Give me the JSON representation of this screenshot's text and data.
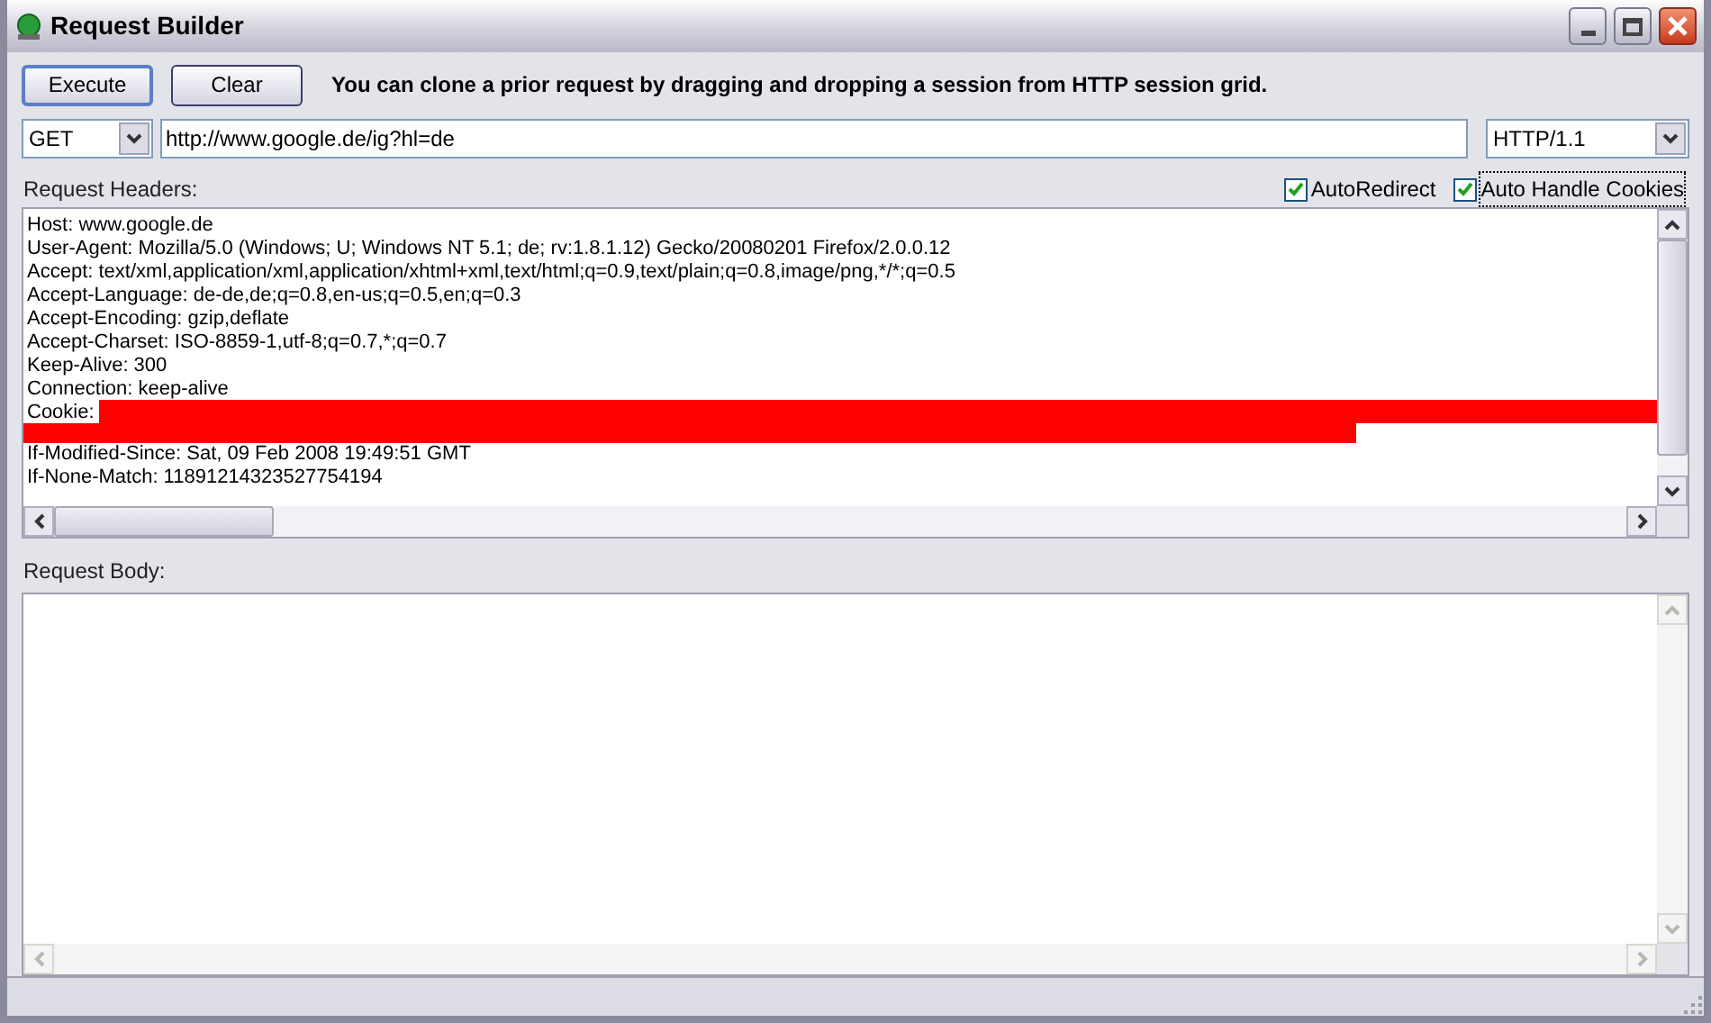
{
  "window": {
    "title": "Request Builder"
  },
  "buttons": [
    {
      "label": "Execute",
      "focused": true
    },
    {
      "label": "Clear",
      "focused": false
    }
  ],
  "hint": "You can clone a prior request by dragging and dropping a session from HTTP session grid.",
  "request_line": {
    "method": "GET",
    "url": "http://www.google.de/ig?hl=de",
    "version": "HTTP/1.1"
  },
  "options": [
    {
      "label": "AutoRedirect",
      "checked": true,
      "focused": false
    },
    {
      "label": "Auto Handle Cookies",
      "checked": true,
      "focused": true
    }
  ],
  "headers": {
    "label": "Request Headers:",
    "lines": [
      {
        "text": "Host: www.google.de",
        "redacted": false
      },
      {
        "text": "User-Agent: Mozilla/5.0 (Windows; U; Windows NT 5.1; de; rv:1.8.1.12) Gecko/20080201 Firefox/2.0.0.12",
        "redacted": false
      },
      {
        "text": "Accept: text/xml,application/xml,application/xhtml+xml,text/html;q=0.9,text/plain;q=0.8,image/png,*/*;q=0.5",
        "redacted": false
      },
      {
        "text": "Accept-Language: de-de,de;q=0.8,en-us;q=0.5,en;q=0.3",
        "redacted": false
      },
      {
        "text": "Accept-Encoding: gzip,deflate",
        "redacted": false
      },
      {
        "text": "Accept-Charset: ISO-8859-1,utf-8;q=0.7,*;q=0.7",
        "redacted": false
      },
      {
        "text": "Keep-Alive: 300",
        "redacted": false
      },
      {
        "text": "Connection: keep-alive",
        "redacted": false
      },
      {
        "text": "Cookie:",
        "redacted": true
      },
      {
        "text": "If-Modified-Since: Sat, 09 Feb 2008 19:49:51 GMT",
        "redacted": false
      },
      {
        "text": "If-None-Match: 11891214323527754194",
        "redacted": false
      }
    ]
  },
  "body": {
    "label": "Request Body:"
  }
}
